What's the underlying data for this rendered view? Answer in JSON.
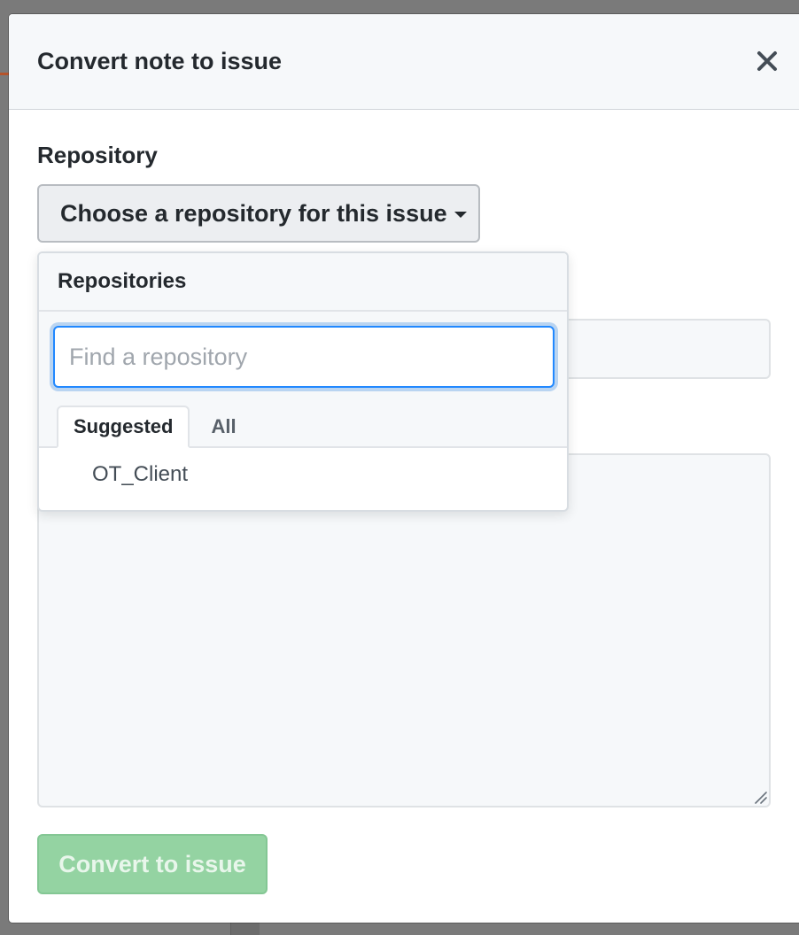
{
  "modal": {
    "title": "Convert note to issue",
    "close_icon": "close-icon"
  },
  "form": {
    "repository_label": "Repository",
    "repository_select_label": "Choose a repository for this issue",
    "submit_label": "Convert to issue"
  },
  "dropdown": {
    "header": "Repositories",
    "filter_placeholder": "Find a repository",
    "filter_value": "",
    "tabs": [
      {
        "label": "Suggested",
        "selected": true
      },
      {
        "label": "All",
        "selected": false
      }
    ],
    "items": [
      {
        "label": "OT_Client"
      }
    ]
  },
  "colors": {
    "primary_disabled": "#94d3a2",
    "focus_ring": "#2188ff",
    "text": "#24292e",
    "backdrop": "#7a7a7a"
  }
}
